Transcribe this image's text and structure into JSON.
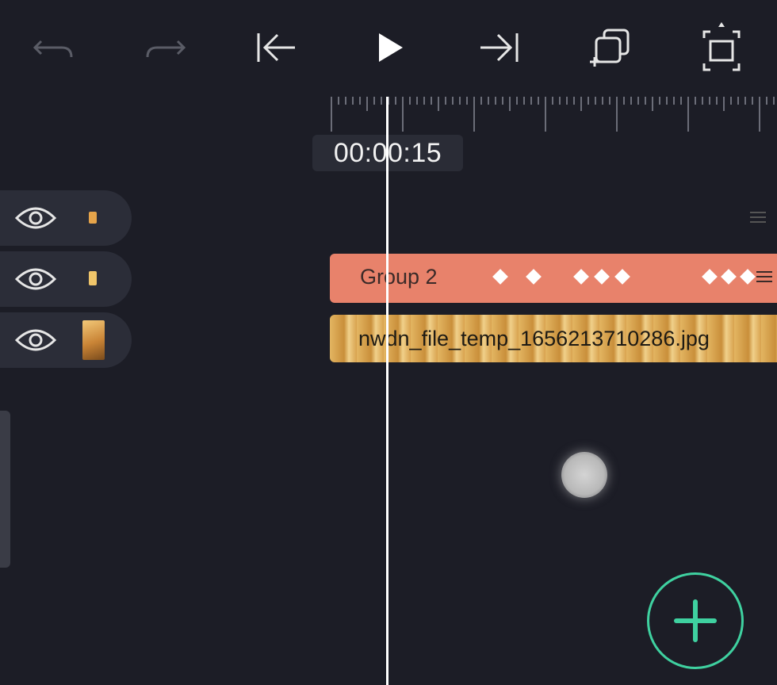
{
  "toolbar": {
    "undo_icon": "undo-icon",
    "redo_icon": "redo-icon",
    "skip_start_icon": "skip-to-start-icon",
    "play_icon": "play-icon",
    "skip_end_icon": "skip-to-end-icon",
    "duplicate_icon": "duplicate-layer-icon",
    "fullscreen_icon": "fullscreen-icon"
  },
  "timeline": {
    "timecode": "00:00:15"
  },
  "layers": [
    {
      "visibility_icon": "eye-icon",
      "thumb": "small-image"
    },
    {
      "visibility_icon": "eye-icon",
      "thumb": "small-image"
    },
    {
      "visibility_icon": "eye-icon",
      "thumb": "image-thumbnail"
    }
  ],
  "tracks": {
    "group_label": "Group 2",
    "image_label": "nwdn_file_temp_1656213710286.jpg"
  },
  "colors": {
    "background": "#1c1d26",
    "group_track": "#e8826b",
    "accent": "#3fd1a0"
  }
}
